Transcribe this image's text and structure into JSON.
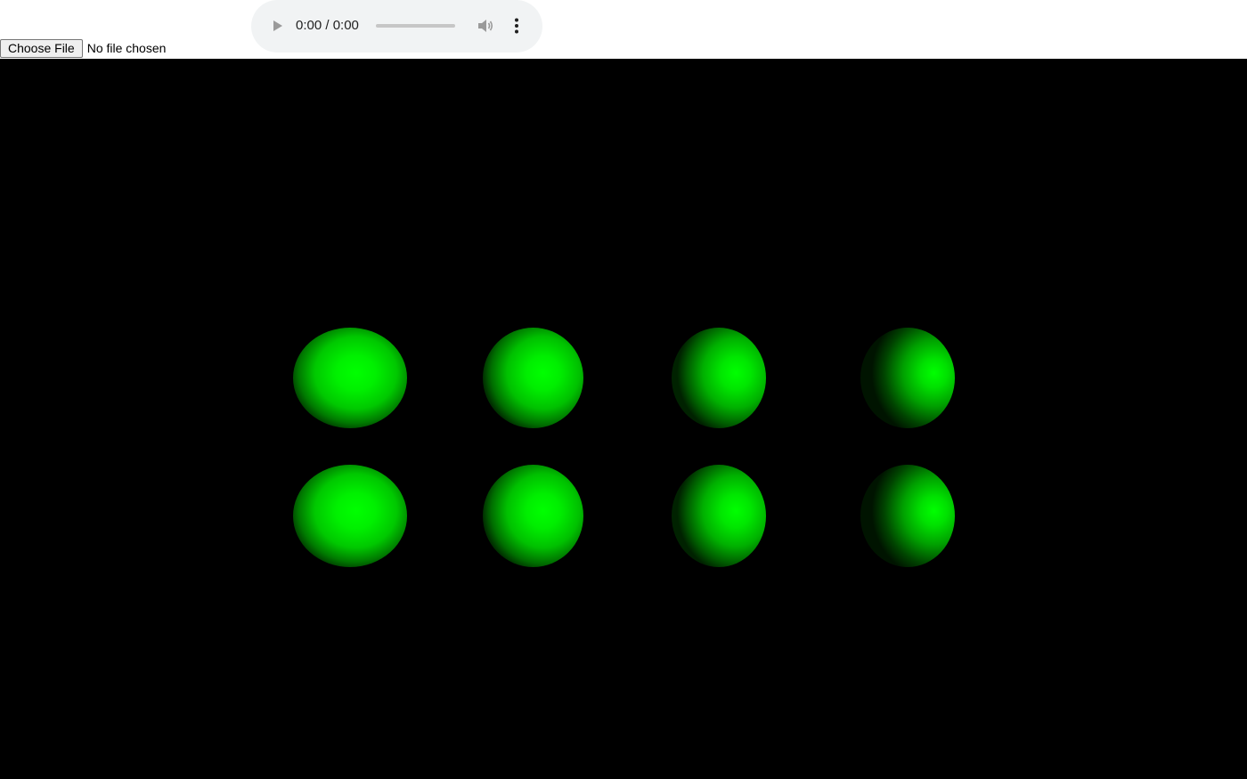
{
  "audio_player": {
    "time_display": "0:00 / 0:00",
    "progress_fraction": 0,
    "play_icon": "play-icon",
    "volume_icon": "volume-icon",
    "more_icon": "more-options-icon"
  },
  "file_input": {
    "button_label": "Choose File",
    "status_text": "No file chosen"
  },
  "scene": {
    "background_color": "#000000",
    "sphere_color": "#00ff00",
    "sphere_count": 8
  }
}
